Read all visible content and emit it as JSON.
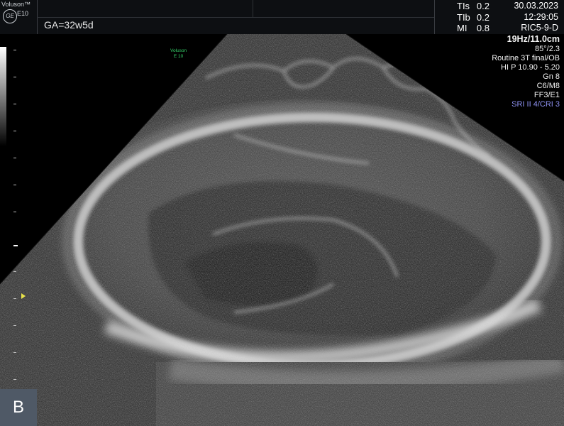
{
  "header": {
    "brand_name": "Voluson™",
    "brand_model": "E10",
    "brand_logo": "GE",
    "gestational_age": "GA=32w5d"
  },
  "safety": [
    {
      "label": "TIs",
      "value": "0.2"
    },
    {
      "label": "TIb",
      "value": "0.2"
    },
    {
      "label": "MI",
      "value": "0.8"
    }
  ],
  "datetime": {
    "date": "30.03.2023",
    "time": "12:29:05",
    "probe": "RIC5-9-D"
  },
  "params": {
    "frame_depth": "19Hz/11.0cm",
    "angle": "85°/2.3",
    "preset": "Routine 3T final/OB",
    "harmonic": "HI P 10.90 - 5.20",
    "gain": "Gn  8",
    "map": "C6/M8",
    "filter": "FF3/E1",
    "sri": "SRI II 4/CRI 3"
  },
  "probe_mark": {
    "line1": "Voluson",
    "line2": "E 10"
  },
  "panel_label": "B",
  "colors": {
    "sri_text": "#8e92f2",
    "probe_mark": "#36d36a",
    "focus_marker": "#e8e24a",
    "panel_label_bg": "#4f5966"
  }
}
